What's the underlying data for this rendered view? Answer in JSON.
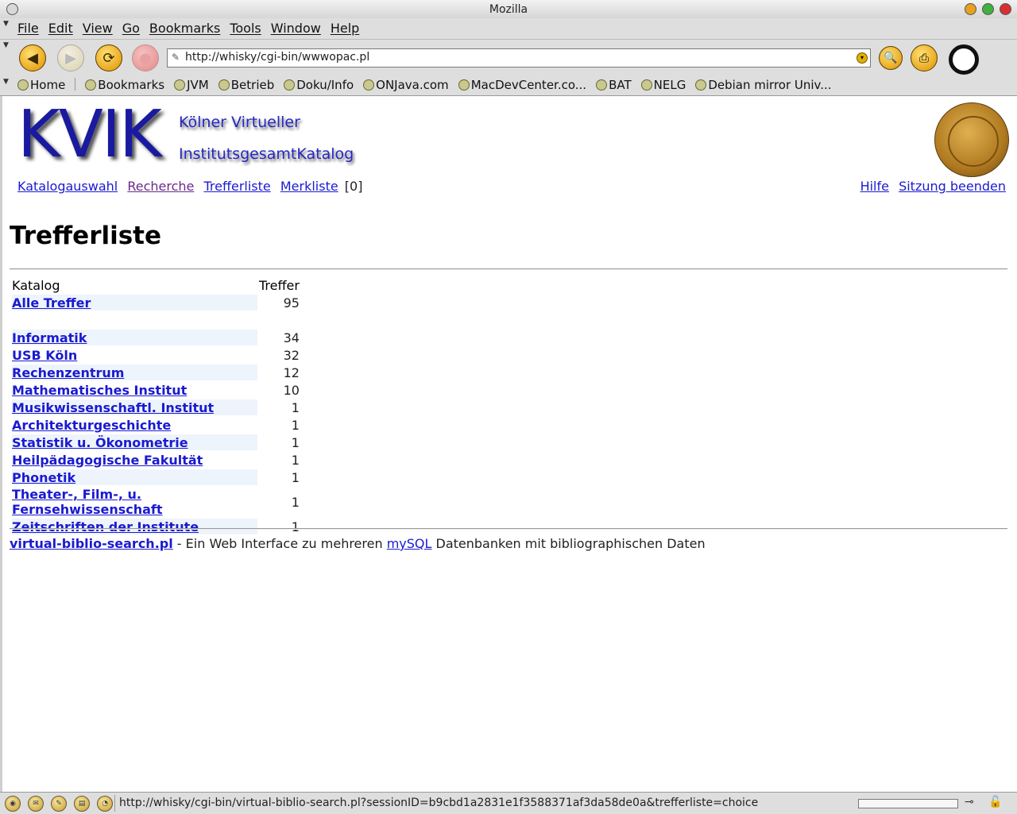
{
  "window": {
    "title": "Mozilla"
  },
  "menu": [
    "File",
    "Edit",
    "View",
    "Go",
    "Bookmarks",
    "Tools",
    "Window",
    "Help"
  ],
  "toolbar": {
    "url": "http://whisky/cgi-bin/wwwopac.pl"
  },
  "personal_toolbar": [
    "Home",
    "Bookmarks",
    "JVM",
    "Betrieb",
    "Doku/Info",
    "ONJava.com",
    "MacDevCenter.co...",
    "BAT",
    "NELG",
    "Debian mirror Univ..."
  ],
  "page": {
    "logo": "KVIK",
    "subtitle1": "Kölner Virtueller",
    "subtitle2": "InstitutsgesamtKatalog",
    "nav": {
      "katalogauswahl": "Katalogauswahl",
      "recherche": "Recherche",
      "trefferliste": "Trefferliste",
      "merkliste": "Merkliste",
      "merkliste_count": "[0]"
    },
    "nav_right": {
      "hilfe": "Hilfe",
      "sitzung": "Sitzung beenden"
    },
    "heading": "Trefferliste",
    "table": {
      "header_katalog": "Katalog",
      "header_treffer": "Treffer",
      "all": {
        "name": "Alle Treffer",
        "count": "95"
      },
      "rows": [
        {
          "name": "Informatik",
          "count": "34"
        },
        {
          "name": "USB Köln",
          "count": "32"
        },
        {
          "name": "Rechenzentrum",
          "count": "12"
        },
        {
          "name": "Mathematisches Institut",
          "count": "10"
        },
        {
          "name": "Musikwissenschaftl. Institut",
          "count": "1"
        },
        {
          "name": "Architekturgeschichte",
          "count": "1"
        },
        {
          "name": "Statistik u. Ökonometrie",
          "count": "1"
        },
        {
          "name": "Heilpädagogische Fakultät",
          "count": "1"
        },
        {
          "name": "Phonetik",
          "count": "1"
        },
        {
          "name": "Theater-, Film-, u. Fernsehwissenschaft",
          "count": "1"
        },
        {
          "name": "Zeitschriften der Institute",
          "count": "1"
        }
      ]
    },
    "footer": {
      "script_link": "virtual-biblio-search.pl",
      "text1": " - Ein Web Interface zu mehreren ",
      "mysql_link": "mySQL",
      "text2": " Datenbanken mit bibliographischen Daten"
    }
  },
  "status": {
    "text": "http://whisky/cgi-bin/virtual-biblio-search.pl?sessionID=b9cbd1a2831e1f3588371af3da58de0a&trefferliste=choice",
    "progress": 0
  }
}
